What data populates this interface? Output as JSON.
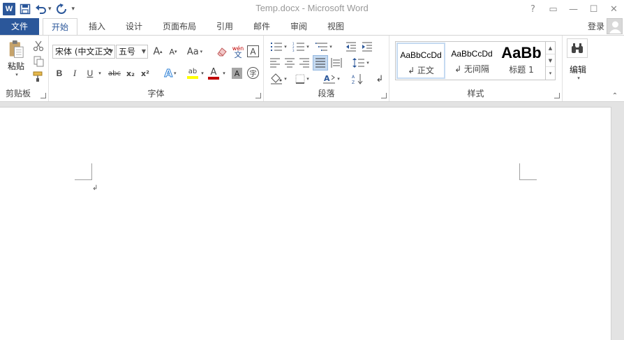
{
  "window": {
    "title": "Temp.docx - Microsoft Word",
    "logo_letter": "W",
    "help": "?",
    "ribbon_display": "▭",
    "minimize": "—",
    "maximize": "☐",
    "close": "✕"
  },
  "qat": {
    "save_icon": "save-icon",
    "undo_icon": "undo-icon",
    "redo_icon": "redo-icon",
    "customize": "▾"
  },
  "tabs": {
    "file": "文件",
    "items": [
      "开始",
      "插入",
      "设计",
      "页面布局",
      "引用",
      "邮件",
      "审阅",
      "视图"
    ],
    "login": "登录"
  },
  "clipboard": {
    "label": "剪贴板",
    "paste": "粘贴"
  },
  "font": {
    "label": "字体",
    "font_name": "宋体 (中文正文",
    "font_size": "五号",
    "grow": "A",
    "shrink": "A",
    "change_case": "Aa",
    "phonetic_top": "wén",
    "phonetic_bottom": "文",
    "border_char": "A",
    "bold": "B",
    "italic": "I",
    "underline": "U",
    "strike": "abc",
    "sub": "x₂",
    "sup": "x²",
    "effects": "A",
    "highlight": "ab",
    "font_color": "A",
    "shading": "A",
    "enclose": "字",
    "highlight_color": "#ffff00",
    "font_color_value": "#c00000"
  },
  "paragraph": {
    "label": "段落"
  },
  "styles": {
    "label": "样式",
    "items": [
      {
        "sample": "AaBbCcDd",
        "name": "↲ 正文"
      },
      {
        "sample": "AaBbCcDd",
        "name": "↲ 无间隔"
      },
      {
        "sample": "AaBb",
        "name": "标题 1"
      }
    ]
  },
  "editing": {
    "label": "编辑"
  },
  "document": {
    "paragraph_mark": "↲"
  },
  "colors": {
    "accent": "#2b579a"
  }
}
